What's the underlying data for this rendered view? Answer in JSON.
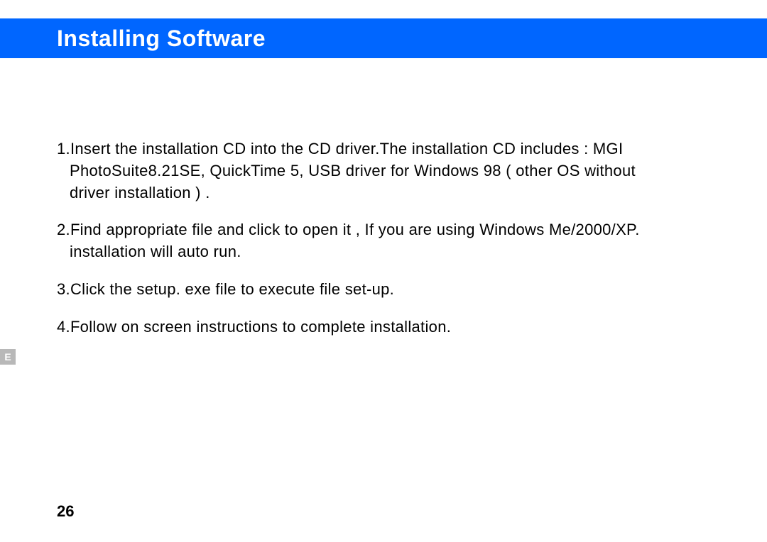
{
  "header": {
    "title": "Installing Software"
  },
  "instructions": {
    "item1_line1": "1.Insert the installation CD into the CD  driver.The installation CD includes :  MGI",
    "item1_line2": "PhotoSuite8.21SE, QuickTime 5, USB driver for Windows 98 ( other OS without",
    "item1_line3": "driver installation ) .",
    "item2_line1": "2.Find appropriate file and click to open it , If you are using Windows Me/2000/XP.",
    "item2_line2": "installation will auto run.",
    "item3": "3.Click the setup. exe file to execute file set-up.",
    "item4": "4.Follow on screen instructions to complete installation."
  },
  "side_tab": "E",
  "page_number": "26"
}
